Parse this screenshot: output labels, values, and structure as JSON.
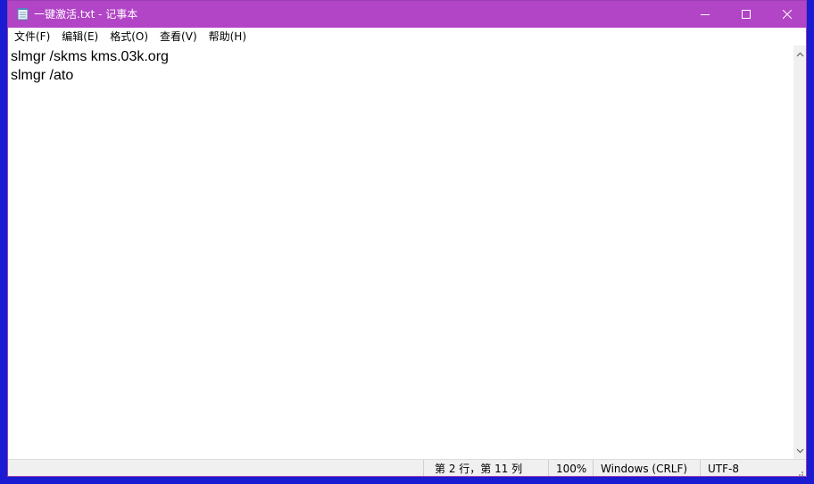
{
  "window": {
    "title": "一键激活.txt - 记事本",
    "app_icon": "notepad-icon",
    "controls": {
      "minimize_icon": "minimize-icon",
      "maximize_icon": "maximize-icon",
      "close_icon": "close-icon"
    },
    "title_bar_color": "#b244c6"
  },
  "menu": {
    "items": [
      {
        "label": "文件(F)"
      },
      {
        "label": "编辑(E)"
      },
      {
        "label": "格式(O)"
      },
      {
        "label": "查看(V)"
      },
      {
        "label": "帮助(H)"
      }
    ]
  },
  "editor": {
    "lines": [
      "slmgr /skms kms.03k.org",
      "slmgr /ato"
    ]
  },
  "status": {
    "position": "第 2 行，第 11 列",
    "zoom": "100%",
    "line_ending": "Windows (CRLF)",
    "encoding": "UTF-8"
  }
}
